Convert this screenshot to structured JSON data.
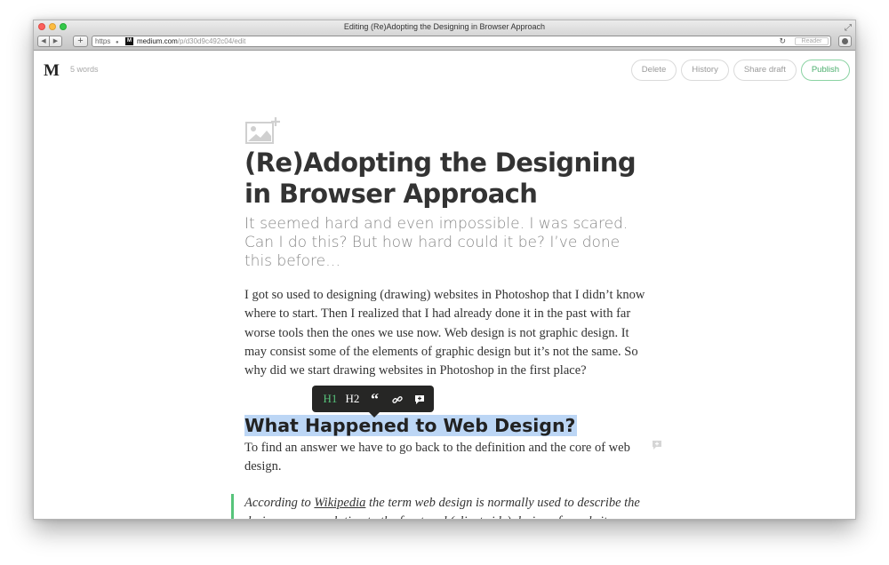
{
  "window": {
    "title": "Editing (Re)Adopting the Designing in Browser Approach"
  },
  "browser": {
    "back_glyph": "◀",
    "forward_glyph": "▶",
    "add_glyph": "+",
    "url_scheme": "https",
    "favicon_letter": "M",
    "url_domain": "medium.com",
    "url_path": "/p/d30d9c492c04/edit",
    "reload_glyph": "↻",
    "reader_label": "Reader"
  },
  "editor": {
    "logo": "M",
    "word_count": "5 words",
    "actions": {
      "delete": "Delete",
      "history": "History",
      "share_draft": "Share draft",
      "publish": "Publish"
    }
  },
  "article": {
    "title": "(Re)Adopting the Designing in Browser Approach",
    "subtitle": "It seemed hard and even impossible. I was scared. Can I do this? But how hard could it be? I’ve done this before…",
    "paragraph1": "I got so used to designing (drawing) websites in Photoshop that I didn’t know where to start. Then I realized that I had already done it in the past with far worse tools then the ones we use now. Web design is not graphic design. It may consist some of the elements of graphic design but it’s not the same. So why did we start drawing websites in Photoshop in the first place?",
    "heading2": "What Happened to Web Design?",
    "paragraph2": "To find an answer we have to go back to the definition and the core of web design.",
    "quote_prefix": "According to ",
    "quote_link": "Wikipedia",
    "quote_rest": " the term web design is normally used to describe the design process relating to the front-end (client side) design of a website including writing"
  },
  "format_toolbar": {
    "h1": "H1",
    "h2": "H2",
    "quote": "“",
    "link_icon": "link-icon",
    "comment_icon": "comment-icon"
  },
  "colors": {
    "accent_green": "#57c47b",
    "selection": "#bcd6f5",
    "toolbar_bg": "#262625"
  }
}
